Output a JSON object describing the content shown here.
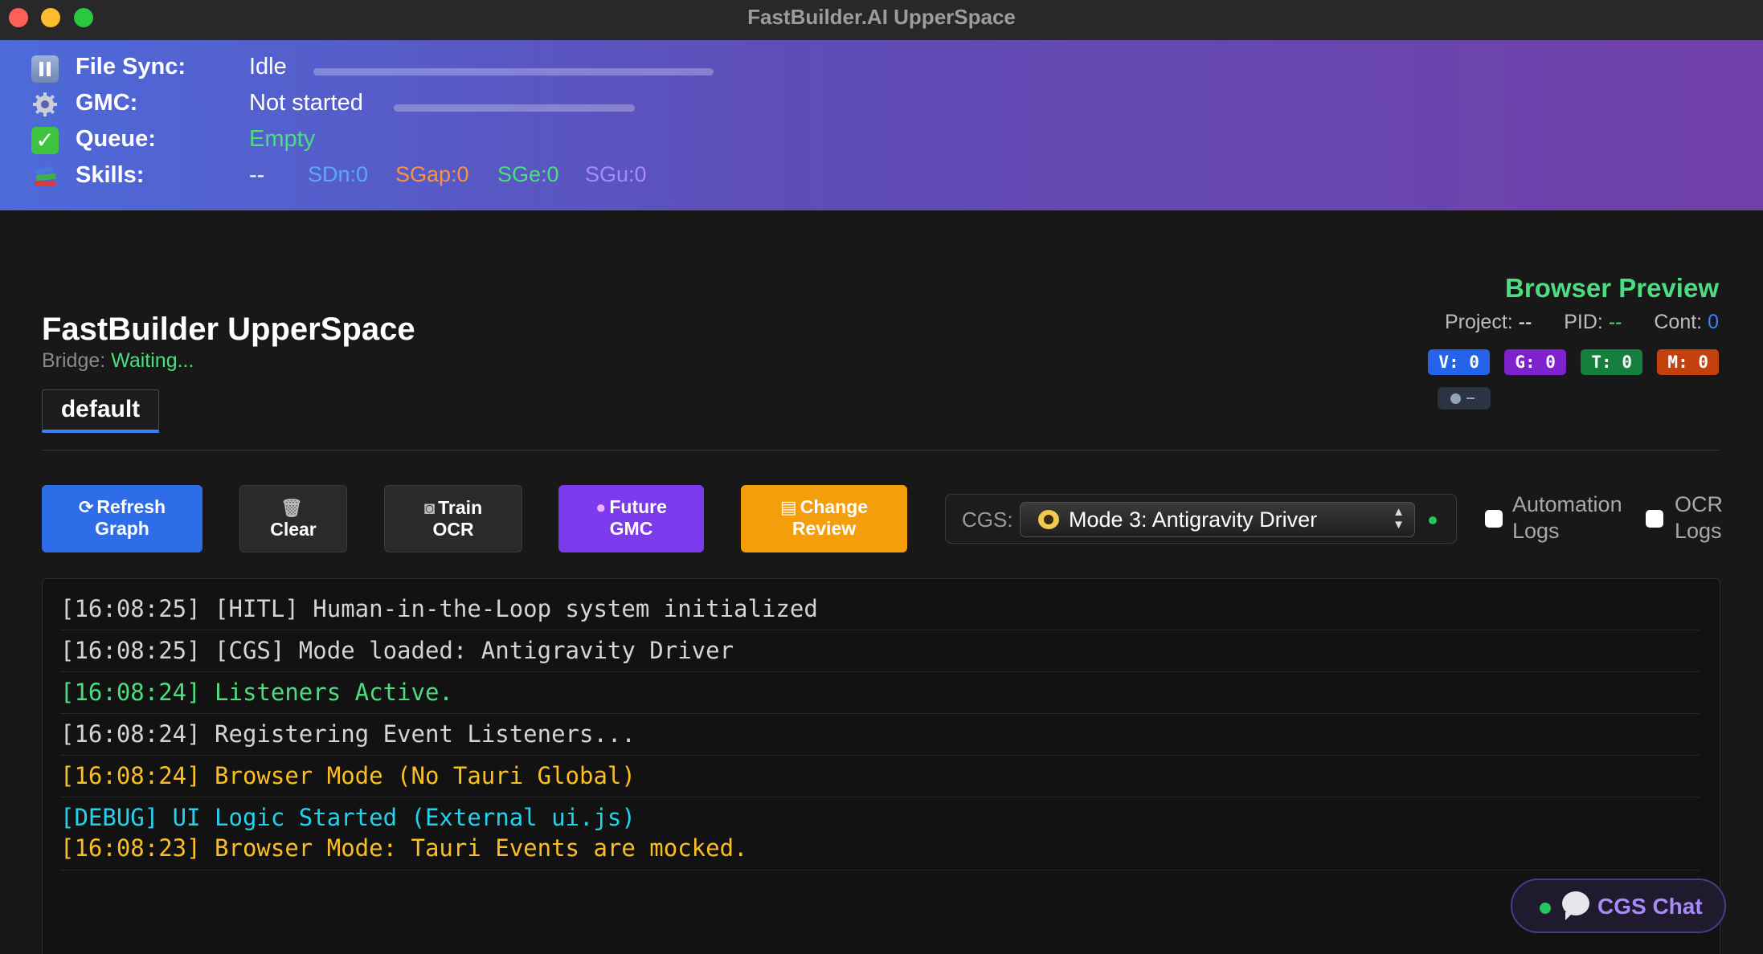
{
  "window": {
    "title": "FastBuilder.AI UpperSpace"
  },
  "status": {
    "file_sync": {
      "icon": "pause-icon",
      "label": "File Sync:",
      "value": "Idle"
    },
    "gmc": {
      "icon": "gear-icon",
      "label": "GMC:",
      "value": "Not started"
    },
    "queue": {
      "icon": "checkmark-icon",
      "label": "Queue:",
      "value": "Empty"
    },
    "skills": {
      "icon": "books-icon",
      "label": "Skills:",
      "value": "--",
      "sdn": "SDn:0",
      "sgap": "SGap:0",
      "sge": "SGe:0",
      "sgu": "SGu:0"
    }
  },
  "header": {
    "title": "FastBuilder UpperSpace",
    "bridge_label": "Bridge:",
    "bridge_value": "Waiting...",
    "tab": "default"
  },
  "preview": {
    "title": "Browser Preview",
    "project_label": "Project:",
    "project_value": "--",
    "pid_label": "PID:",
    "pid_value": "--",
    "cont_label": "Cont:",
    "cont_value": "0",
    "badges": {
      "v": "V: 0",
      "g": "G: 0",
      "t": "T: 0",
      "m": "M: 0"
    }
  },
  "toolbar": {
    "refresh": {
      "line1": "Refresh",
      "line2": "Graph",
      "icon": "refresh-icon"
    },
    "clear": {
      "label": "Clear",
      "icon": "trash-icon"
    },
    "train": {
      "line1": "Train",
      "line2": "OCR",
      "icon": "camera-icon"
    },
    "future": {
      "line1": "Future",
      "line2": "GMC",
      "icon": "crystal-ball-icon"
    },
    "change": {
      "line1": "Change",
      "line2": "Review",
      "icon": "clipboard-icon"
    },
    "cgs_label": "CGS:",
    "cgs_selected": "Mode 3: Antigravity Driver",
    "automation_logs_1": "Automation",
    "automation_logs_2": "Logs",
    "ocr_logs_1": "OCR",
    "ocr_logs_2": "Logs"
  },
  "logs": [
    {
      "text": "[16:08:25] [HITL] Human-in-the-Loop system initialized",
      "color": "#d4d4d4"
    },
    {
      "text": "[16:08:25] [CGS] Mode loaded: Antigravity Driver",
      "color": "#d4d4d4"
    },
    {
      "text": "[16:08:24] Listeners Active.",
      "color": "#4ade80"
    },
    {
      "text": "[16:08:24] Registering Event Listeners...",
      "color": "#d4d4d4"
    },
    {
      "text": "[16:08:24] Browser Mode (No Tauri Global)",
      "color": "#fbbf24"
    },
    {
      "text": "[DEBUG] UI Logic Started (External ui.js)",
      "color": "#22d3ee"
    },
    {
      "text": "[16:08:23] Browser Mode: Tauri Events are mocked.",
      "color": "#fbbf24"
    }
  ],
  "chat": {
    "label": "CGS Chat"
  },
  "colors": {
    "accent_green": "#4ade80",
    "accent_blue": "#3b82f6",
    "sdn": "#60a5fa",
    "sgap": "#fb923c",
    "sge": "#4ade80",
    "sgu": "#a78bfa"
  }
}
